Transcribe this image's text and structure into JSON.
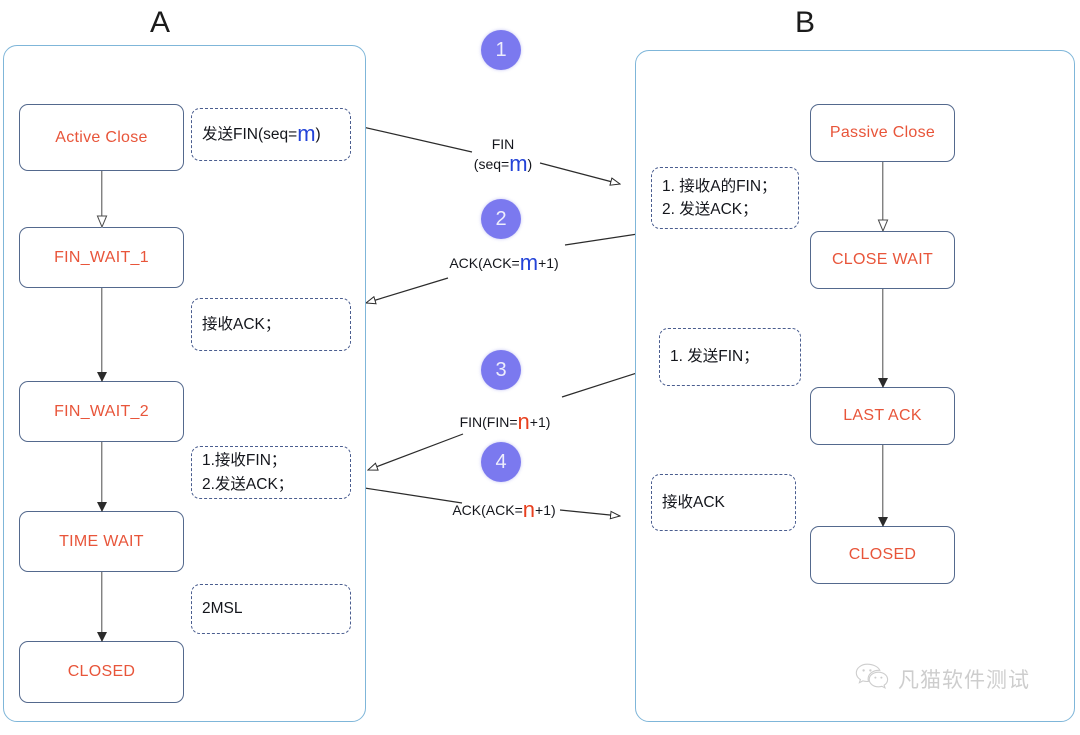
{
  "diagram": {
    "title_left": "A",
    "title_right": "B"
  },
  "left_panel": {
    "states": [
      {
        "label": "Active Close"
      },
      {
        "label": "FIN_WAIT_1"
      },
      {
        "label": "FIN_WAIT_2"
      },
      {
        "label": "TIME WAIT"
      },
      {
        "label": "CLOSED"
      }
    ],
    "notes": [
      {
        "lines": [
          "发送FIN(seq=",
          "m",
          ")"
        ],
        "prefix": "发送FIN(seq=",
        "token": "m",
        "suffix": ")"
      },
      {
        "lines": [
          "接收ACK；"
        ]
      },
      {
        "lines": [
          "1.接收FIN；",
          "2.发送ACK；"
        ]
      },
      {
        "lines": [
          "2MSL"
        ]
      }
    ],
    "note_send_fin_prefix": "发送FIN(seq=",
    "note_send_fin_token": "m",
    "note_send_fin_suffix": ")",
    "note_recv_ack": "接收ACK；",
    "note_recv_fin_line1": "1.接收FIN；",
    "note_recv_fin_line2": "2.发送ACK；",
    "note_2msl": "2MSL"
  },
  "right_panel": {
    "states": [
      {
        "label": "Passive Close"
      },
      {
        "label": "CLOSE WAIT"
      },
      {
        "label": "LAST ACK"
      },
      {
        "label": "CLOSED"
      }
    ],
    "note_recv_fin_line1": "1. 接收A的FIN；",
    "note_recv_fin_line2": "2. 发送ACK；",
    "note_send_fin": "1. 发送FIN；",
    "note_recv_ack": "接收ACK"
  },
  "messages": [
    {
      "step": "1",
      "line1": "FIN",
      "line2_prefix": "(seq=",
      "line2_token": "m",
      "line2_suffix": ")",
      "token_color": "#2343d8",
      "direction": "A-to-B"
    },
    {
      "step": "2",
      "line1": "",
      "line2_prefix": "ACK(ACK=",
      "line2_token": "m",
      "line2_suffix": "+1)",
      "token_color": "#2343d8",
      "direction": "B-to-A"
    },
    {
      "step": "3",
      "line1": "",
      "line2_prefix": "FIN(FIN=",
      "line2_token": "n",
      "line2_suffix": "+1)",
      "token_color": "#e8401f",
      "direction": "B-to-A"
    },
    {
      "step": "4",
      "line1": "",
      "line2_prefix": "ACK(ACK=",
      "line2_token": "n",
      "line2_suffix": "+1)",
      "token_color": "#e8401f",
      "direction": "A-to-B"
    }
  ],
  "watermark": {
    "icon": "wechat-icon",
    "text": "凡猫软件测试"
  },
  "colors": {
    "state_text": "#e8553a",
    "state_border": "#54698d",
    "panel_border": "#7fb6d9",
    "note_border": "#4a5d8f",
    "badge_bg": "#7b79ef",
    "token_blue": "#2343d8",
    "token_red": "#e8401f"
  }
}
